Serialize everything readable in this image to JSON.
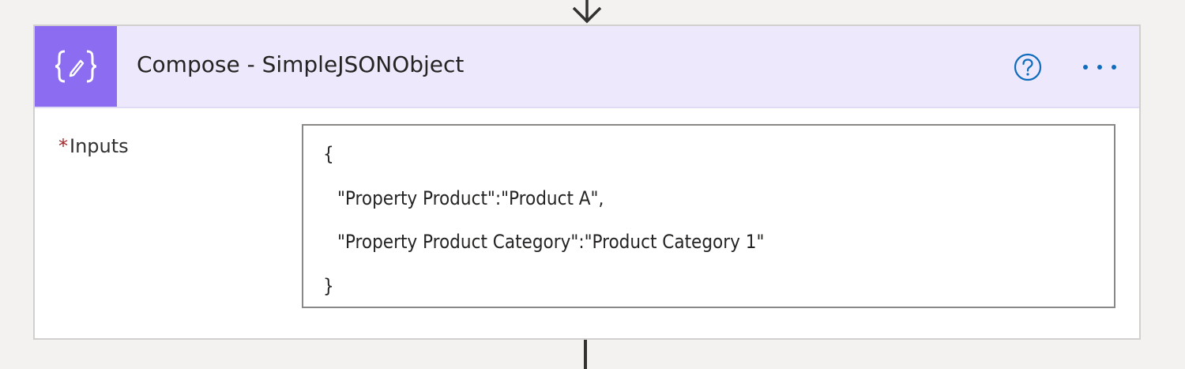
{
  "action": {
    "title": "Compose - SimpleJSONObject",
    "icon": "compose-braces-icon",
    "accent_color": "#8c6cf0",
    "header_bg": "#ede8fb"
  },
  "toolbar": {
    "help_icon": "help-circle-icon",
    "more_icon": "ellipsis-icon"
  },
  "inputs_field": {
    "required_marker": "*",
    "label": "Inputs",
    "lines": [
      "{",
      "\"Property Product\":\"Product A\",",
      "\"Property Product Category\":\"Product Category 1\"",
      "}"
    ]
  }
}
